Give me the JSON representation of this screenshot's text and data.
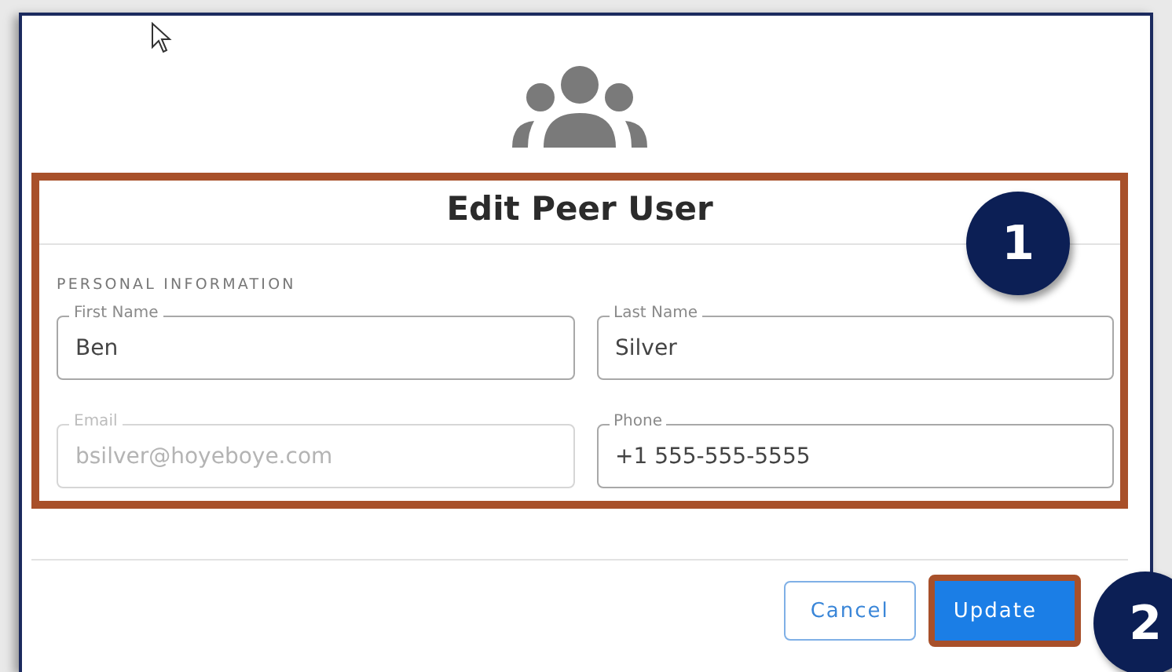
{
  "dialog": {
    "title": "Edit Peer User",
    "section_label": "PERSONAL INFORMATION",
    "fields": [
      {
        "label": "First Name",
        "value": "Ben",
        "disabled": false
      },
      {
        "label": "Last Name",
        "value": "Silver",
        "disabled": false
      },
      {
        "label": "Email",
        "value": "bsilver@hoyeboye.com",
        "disabled": true
      },
      {
        "label": "Phone",
        "value": "+1 555-555-5555",
        "disabled": false
      }
    ],
    "buttons": [
      {
        "label": "Cancel",
        "kind": "secondary"
      },
      {
        "label": "Update",
        "kind": "primary"
      }
    ]
  },
  "callouts": [
    "1",
    "2"
  ]
}
